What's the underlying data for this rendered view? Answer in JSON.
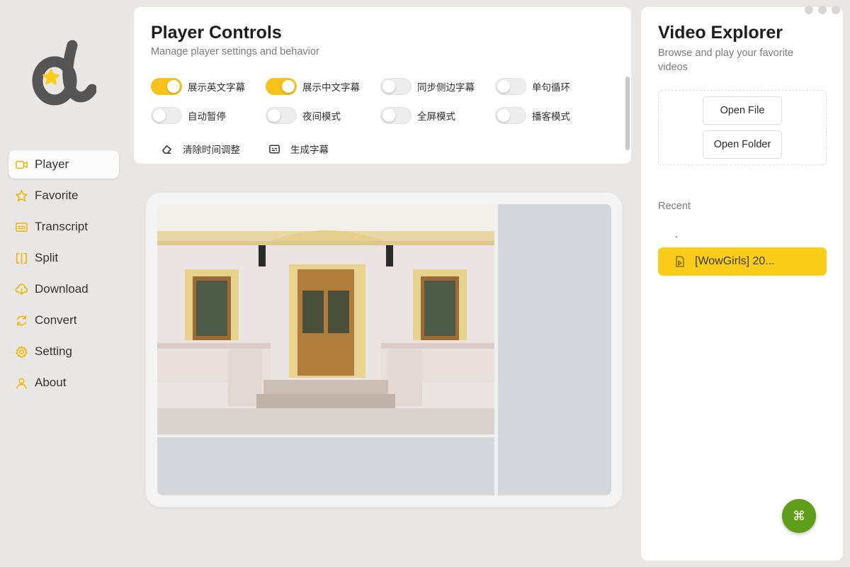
{
  "window": {
    "controls": [
      "dot",
      "dot",
      "dot"
    ]
  },
  "sidebar": {
    "logo": "d-logo-with-star",
    "items": [
      {
        "label": "Player",
        "icon": "video-camera-icon",
        "active": true
      },
      {
        "label": "Favorite",
        "icon": "star-icon",
        "active": false
      },
      {
        "label": "Transcript",
        "icon": "caption-icon",
        "active": false
      },
      {
        "label": "Split",
        "icon": "split-icon",
        "active": false
      },
      {
        "label": "Download",
        "icon": "cloud-download-icon",
        "active": false
      },
      {
        "label": "Convert",
        "icon": "convert-icon",
        "active": false
      },
      {
        "label": "Setting",
        "icon": "gear-icon",
        "active": false
      },
      {
        "label": "About",
        "icon": "user-icon",
        "active": false
      }
    ]
  },
  "controls": {
    "title": "Player Controls",
    "subtitle": "Manage player settings and behavior",
    "toggles": [
      {
        "label": "展示英文字幕",
        "on": true
      },
      {
        "label": "展示中文字幕",
        "on": true
      },
      {
        "label": "同步侧边字幕",
        "on": false
      },
      {
        "label": "单句循环",
        "on": false
      },
      {
        "label": "自动暂停",
        "on": false
      },
      {
        "label": "夜间模式",
        "on": false
      },
      {
        "label": "全屏模式",
        "on": false
      },
      {
        "label": "播客模式",
        "on": false
      }
    ],
    "actions": [
      {
        "label": "清除时间调整",
        "icon": "eraser-icon"
      },
      {
        "label": "生成字幕",
        "icon": "subtitle-icon"
      }
    ]
  },
  "explorer": {
    "title": "Video Explorer",
    "subtitle": "Browse and play your favorite videos",
    "open_file": "Open File",
    "open_folder": "Open Folder",
    "recent_label": "Recent",
    "recent_parent": ".",
    "recent_items": [
      {
        "name": "[WowGirls] 20...",
        "icon": "video-file-icon"
      }
    ]
  },
  "fab": {
    "symbol": "⌘",
    "color": "#5e9f1a"
  },
  "colors": {
    "accent": "#f6c21b",
    "recent_highlight": "#f9cd1a",
    "sidebar_bg": "#e8e7e5"
  }
}
